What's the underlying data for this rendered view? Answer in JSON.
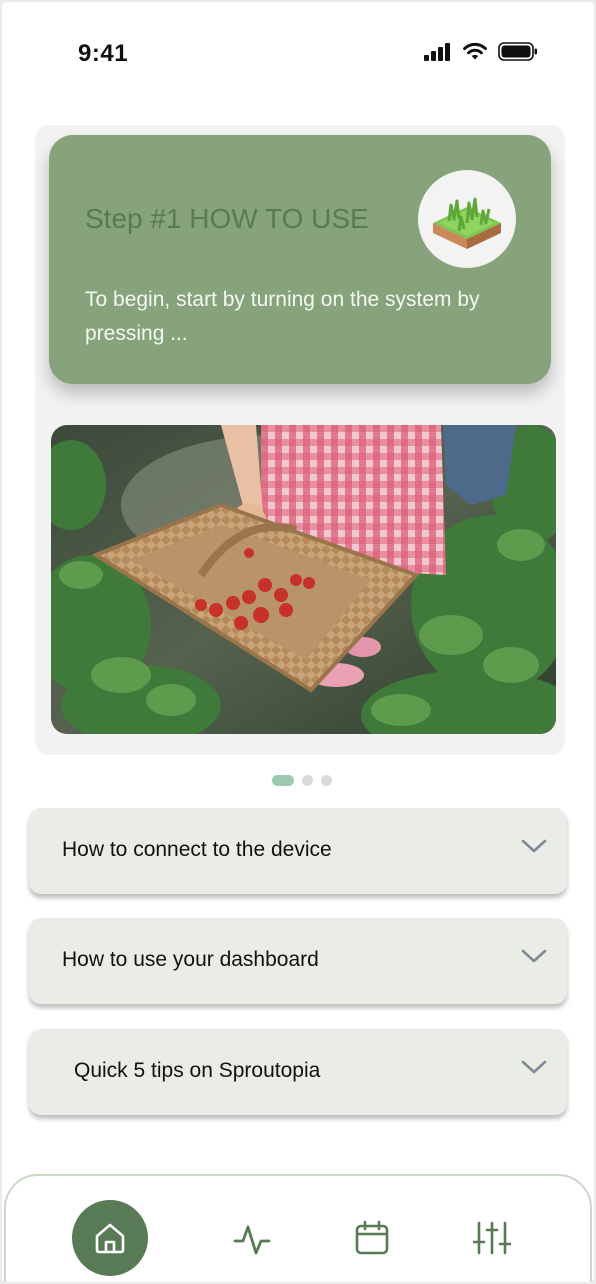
{
  "status_bar": {
    "time": "9:41"
  },
  "carousel": {
    "step_title": "Step #1 HOW TO USE",
    "step_body": "To begin, start by turning on the system by pressing ...",
    "active_index": 0,
    "total": 3
  },
  "faq": [
    {
      "label": "How to connect to the device"
    },
    {
      "label": "How to use your dashboard"
    },
    {
      "label": "Quick 5 tips on Sproutopia"
    }
  ],
  "nav": {
    "items": [
      "home-icon",
      "activity-icon",
      "calendar-icon",
      "sliders-icon"
    ],
    "active": "home-icon"
  },
  "colors": {
    "accent": "#587a55",
    "card": "#86a37b",
    "accordion_bg": "#e9ede6",
    "dot_active": "#9cc9b0"
  }
}
